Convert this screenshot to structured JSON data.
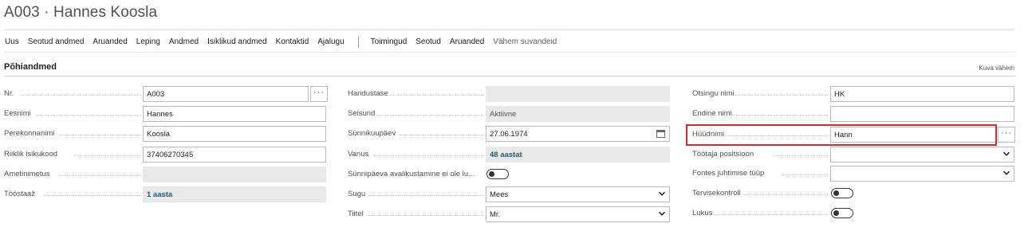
{
  "title": "A003 · Hannes Koosla",
  "actions": {
    "new": "Uus",
    "related_data": "Seotud andmed",
    "reports": "Aruanded",
    "contract": "Leping",
    "data": "Andmed",
    "personal_data": "Isiklikud andmed",
    "contacts": "Kontaktid",
    "history": "Ajalugu",
    "actions": "Toimingud",
    "related": "Seotud",
    "reports2": "Aruanded",
    "fewer_options": "Vähem suvandeid"
  },
  "section": {
    "title": "Põhiandmed",
    "show_less": "Kuva vähem"
  },
  "fields": {
    "nr": {
      "label": "Nr.",
      "value": "A003"
    },
    "first_name": {
      "label": "Eesnimi",
      "value": "Hannes"
    },
    "last_name": {
      "label": "Perekonnanimi",
      "value": "Koosla"
    },
    "id_code": {
      "label": "Riiklik isikukood",
      "value": "37406270345"
    },
    "job_title": {
      "label": "Ametinimetus",
      "value": ""
    },
    "seniority": {
      "label": "Tööstaaž",
      "value": "1 aasta"
    },
    "education": {
      "label": "Haridustase",
      "value": ""
    },
    "status": {
      "label": "Seisund",
      "value": "Aktiivne"
    },
    "birth_date": {
      "label": "Sünnikuupäev",
      "value": "27.06.1974"
    },
    "age": {
      "label": "Vanus",
      "value": "48 aastat"
    },
    "birthday_private": {
      "label": "Sünnipäeva avalikustamine ei ole lu...",
      "value": false
    },
    "gender": {
      "label": "Sugu",
      "value": "Mees"
    },
    "salutation": {
      "label": "Tiitel",
      "value": "Mr."
    },
    "search_name": {
      "label": "Otsingu nimi",
      "value": "HK"
    },
    "former_name": {
      "label": "Endine nimi",
      "value": ""
    },
    "nickname": {
      "label": "Hüüdnimi",
      "value": "Hann"
    },
    "position": {
      "label": "Töötaja positsioon",
      "value": ""
    },
    "fontes_type": {
      "label": "Fontes juhtimise tüüp",
      "value": ""
    },
    "health_check": {
      "label": "Tervisekontroll",
      "value": false
    },
    "locked": {
      "label": "Lukus",
      "value": false
    }
  },
  "assist_glyph": "···",
  "colors": {
    "highlight_border": "#d02b2b",
    "bold_value": "#1f5f6d",
    "readonly_bg": "#e8e8e8"
  }
}
